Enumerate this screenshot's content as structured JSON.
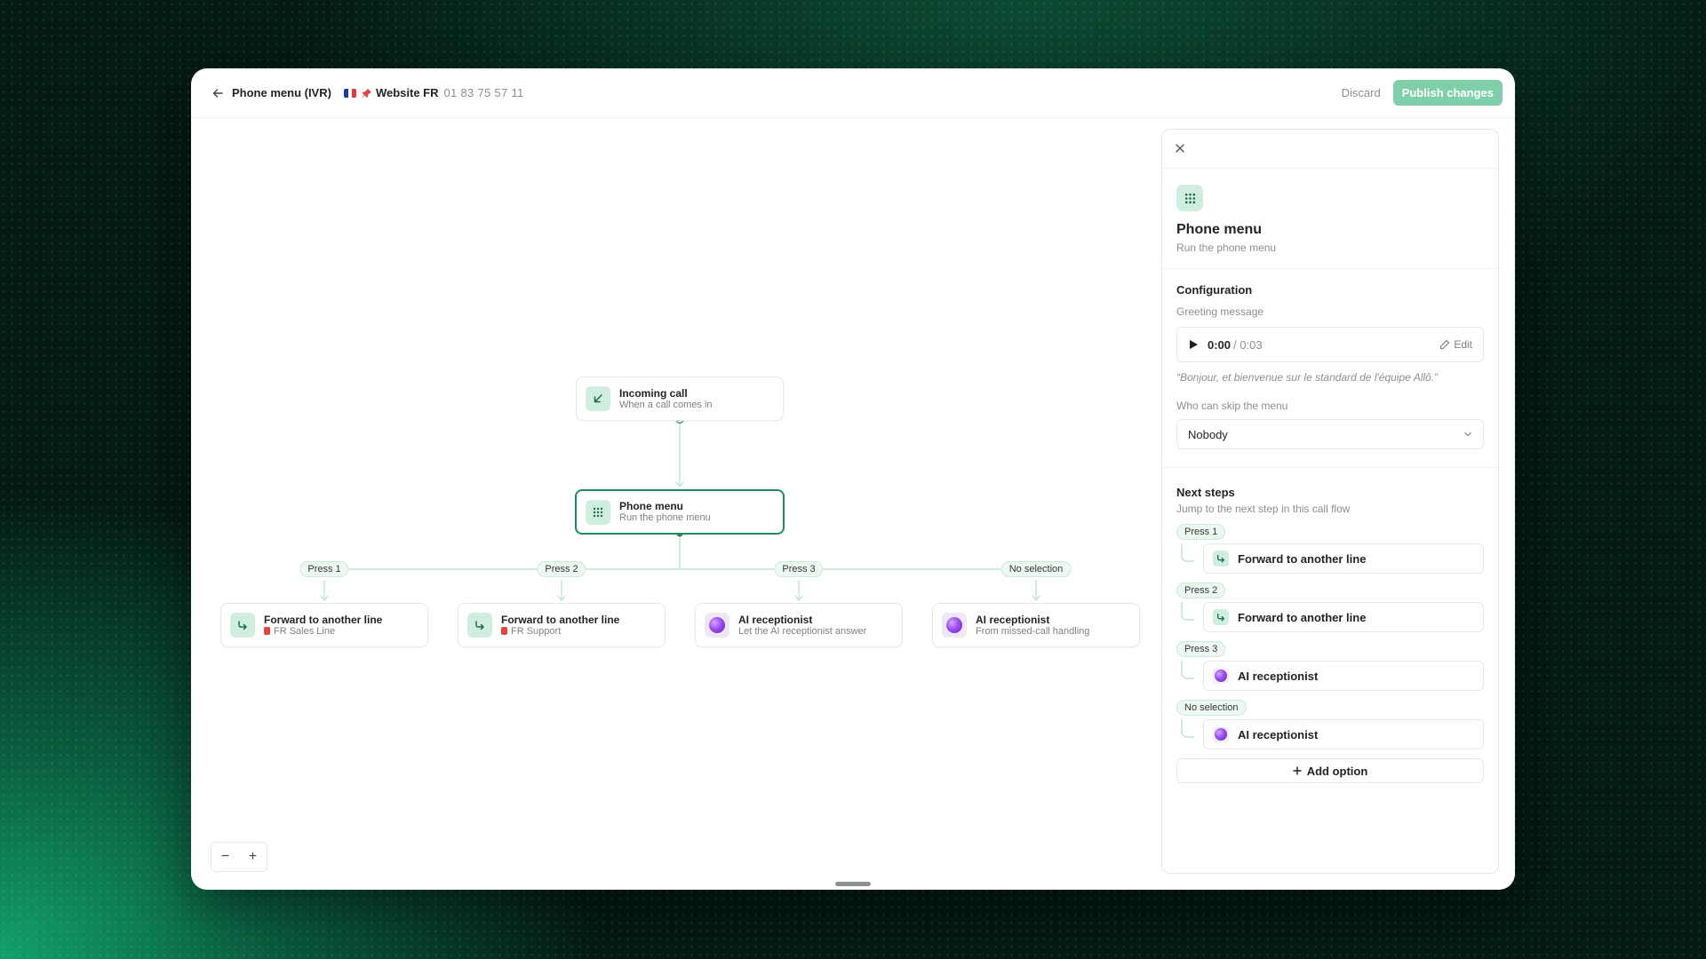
{
  "header": {
    "title": "Phone menu (IVR)",
    "line_name": "Website FR",
    "line_number": "01 83 75 57 11",
    "discard_label": "Discard",
    "publish_label": "Publish changes"
  },
  "colors": {
    "accent": "#1e8a5d",
    "publish_bg": "#7fd0aa",
    "node_icon_bg": "#cfeee0",
    "pill_bg": "#eef8f2"
  },
  "flow": {
    "incoming": {
      "title": "Incoming call",
      "subtitle": "When a call comes in",
      "icon": "arrow-down-left-icon"
    },
    "menu": {
      "title": "Phone menu",
      "subtitle": "Run the phone menu",
      "icon": "keypad-icon"
    },
    "branches": [
      {
        "label": "Press 1",
        "title": "Forward to another line",
        "subtitle": "FR Sales Line",
        "icon": "forward-icon"
      },
      {
        "label": "Press 2",
        "title": "Forward to another line",
        "subtitle": "FR Support",
        "icon": "forward-icon"
      },
      {
        "label": "Press 3",
        "title": "AI receptionist",
        "subtitle": "Let the AI receptionist answer",
        "icon": "ai-orb-icon"
      },
      {
        "label": "No selection",
        "title": "AI receptionist",
        "subtitle": "From missed-call handling",
        "icon": "ai-orb-icon"
      }
    ]
  },
  "zoom": {
    "out_label": "−",
    "in_label": "+"
  },
  "panel": {
    "title": "Phone menu",
    "subtitle": "Run the phone menu",
    "config_title": "Configuration",
    "greeting_label": "Greeting message",
    "audio_current": "0:00",
    "audio_total": "/ 0:03",
    "edit_label": "Edit",
    "greeting_text": "“Bonjour, et bienvenue sur le standard de l'équipe Allô.”",
    "skip_label": "Who can skip the menu",
    "skip_value": "Nobody",
    "next_title": "Next steps",
    "next_sub": "Jump to the next step in this call flow",
    "steps": [
      {
        "label": "Press 1",
        "target": "Forward to another line",
        "icon": "forward-icon"
      },
      {
        "label": "Press 2",
        "target": "Forward to another line",
        "icon": "forward-icon"
      },
      {
        "label": "Press 3",
        "target": "AI receptionist",
        "icon": "ai-orb-icon"
      },
      {
        "label": "No selection",
        "target": "AI receptionist",
        "icon": "ai-orb-icon"
      }
    ],
    "add_option_label": "Add option"
  }
}
